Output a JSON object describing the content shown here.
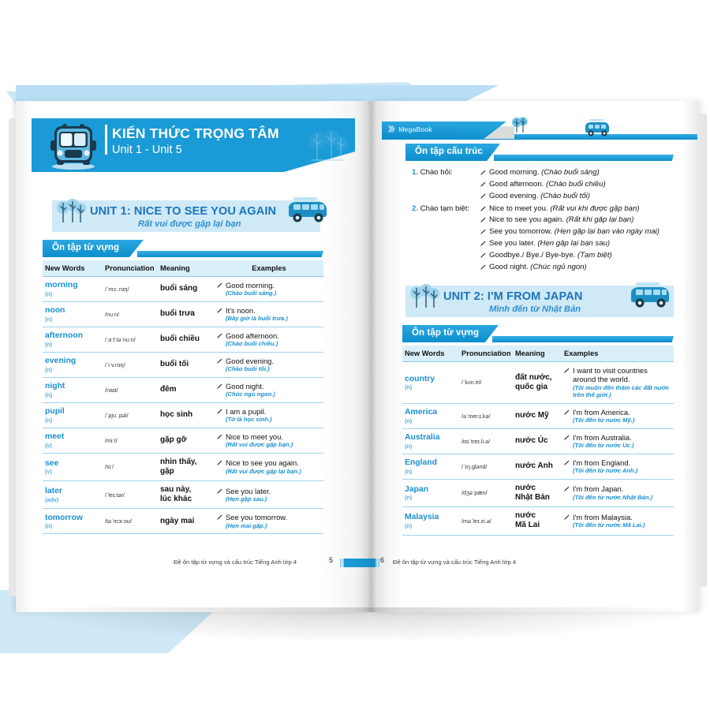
{
  "book": {
    "header": {
      "title": "KIẾN THỨC TRỌNG TÂM",
      "subtitle": "Unit 1 - Unit 5",
      "bus_icon": "school-bus-icon",
      "trees_icon": "trees-icon"
    },
    "brand": {
      "logo_text": "MegaBook",
      "chevrons": "〉〉〉"
    },
    "footer": {
      "left_text": "Đề ôn tập từ vựng và cấu trúc Tiếng Anh lớp 4",
      "left_page": "5",
      "right_page": "6",
      "right_text": "Đề ôn tập từ vựng và cấu trúc Tiếng Anh lớp 4"
    }
  },
  "left_page": {
    "unit": {
      "title": "UNIT 1: NICE TO SEE YOU AGAIN",
      "subtitle": "Rất vui được gặp lại bạn",
      "trees_icon": "trees-icon",
      "van_icon": "van-icon"
    },
    "section": {
      "label": "Ôn tập từ vựng"
    },
    "table": {
      "columns": [
        "New Words",
        "Pronunciation",
        "Meaning",
        "Examples"
      ],
      "rows": [
        {
          "word": "morning",
          "pos": "(n)",
          "ipa": "/ˈmɔː.nɪŋ/",
          "meaning": "buổi sáng",
          "example": "Good morning.",
          "vn": "(Chào buổi sáng.)"
        },
        {
          "word": "noon",
          "pos": "(n)",
          "ipa": "/nuːn/",
          "meaning": "buổi trưa",
          "example": "It's noon.",
          "vn": "(Bây giờ là buổi trưa.)"
        },
        {
          "word": "afternoon",
          "pos": "(n)",
          "ipa": "/ˌɑːf.təˈnuːn/",
          "meaning": "buổi chiều",
          "example": "Good afternoon.",
          "vn": "(Chào buổi chiều.)"
        },
        {
          "word": "evening",
          "pos": "(n)",
          "ipa": "/ˈiːv.nɪŋ/",
          "meaning": "buổi tối",
          "example": "Good evening.",
          "vn": "(Chào buổi tối.)"
        },
        {
          "word": "night",
          "pos": "(n)",
          "ipa": "/naɪt/",
          "meaning": "đêm",
          "example": "Good night.",
          "vn": "(Chúc ngủ ngon.)"
        },
        {
          "word": "pupil",
          "pos": "(n)",
          "ipa": "/ˈpjuː.pəl/",
          "meaning": "học sinh",
          "example": "I am a pupil.",
          "vn": "(Tớ là học sinh.)"
        },
        {
          "word": "meet",
          "pos": "(v)",
          "ipa": "/miːt/",
          "meaning": "gặp gỡ",
          "example": "Nice to meet you.",
          "vn": "(Rất vui được gặp bạn.)"
        },
        {
          "word": "see",
          "pos": "(v)",
          "ipa": "/siː/",
          "meaning": "nhìn thấy, gặp",
          "example": "Nice to see you again.",
          "vn": "(Rất vui được gặp lại bạn.)"
        },
        {
          "word": "later",
          "pos": "(adv)",
          "ipa": "/ˈleɪ.tər/",
          "meaning": "sau này,\nlúc khác",
          "example": "See you later.",
          "vn": "(Hẹn gặp sau.)"
        },
        {
          "word": "tomorrow",
          "pos": "(n)",
          "ipa": "/təˈmɔr.oʊ/",
          "meaning": "ngày mai",
          "example": "See you tomorrow.",
          "vn": "(Hẹn mai gặp.)"
        }
      ]
    }
  },
  "right_page": {
    "structure_section": {
      "label": "Ôn tập cấu trúc"
    },
    "structures": [
      {
        "num": "1.",
        "heading": "Chào hỏi:",
        "items": [
          {
            "en": "Good morning.",
            "vn": "(Chào buổi sáng)"
          },
          {
            "en": "Good afternoon.",
            "vn": "(Chào buổi chiều)"
          },
          {
            "en": "Good evening.",
            "vn": "(Chào buổi tối)"
          }
        ]
      },
      {
        "num": "2.",
        "heading": "Chào tạm biệt:",
        "items": [
          {
            "en": "Nice to meet you.",
            "vn": "(Rất vui khi được gặp bạn)"
          },
          {
            "en": "Nice to see you again.",
            "vn": "(Rất khi gặp lại bạn)"
          },
          {
            "en": "See you tomorrow.",
            "vn": "(Hẹn gặp lại bạn vào ngày mai)"
          },
          {
            "en": "See you later.",
            "vn": "(Hẹn gặp lại bạn sau)"
          },
          {
            "en": "Goodbye./ Bye./ Bye-bye.",
            "vn": "(Tạm biệt)"
          },
          {
            "en": "Good night.",
            "vn": "(Chúc ngủ ngon)"
          }
        ]
      }
    ],
    "unit": {
      "title": "UNIT 2: I'M FROM JAPAN",
      "subtitle": "Mình đến từ Nhật Bản",
      "trees_icon": "trees-icon",
      "van_icon": "van-icon"
    },
    "section": {
      "label": "Ôn tập từ vựng"
    },
    "table": {
      "columns": [
        "New Words",
        "Pronunciation",
        "Meaning",
        "Examples"
      ],
      "rows": [
        {
          "word": "country",
          "pos": "(n)",
          "ipa": "/ˈkʌn.tri/",
          "meaning": "đất nước,\nquốc gia",
          "example": "I want to visit countries around the world.",
          "vn": "(Tôi muốn đến thăm các đất nước trên thế giới.)"
        },
        {
          "word": "America",
          "pos": "(n)",
          "ipa": "/əˈmer.ɪ.kə/",
          "meaning": "nước Mỹ",
          "example": "I'm from America.",
          "vn": "(Tôi đến từ nước Mỹ.)"
        },
        {
          "word": "Australia",
          "pos": "(n)",
          "ipa": "/ɒsˈtreɪ.li.ə/",
          "meaning": "nước Úc",
          "example": "I'm from Australia.",
          "vn": "(Tôi đến từ nước Úc.)"
        },
        {
          "word": "England",
          "pos": "(n)",
          "ipa": "/ˈɪŋ.ɡlənd/",
          "meaning": "nước Anh",
          "example": "I'm from England.",
          "vn": "(Tôi đến từ nước Anh.)"
        },
        {
          "word": "Japan",
          "pos": "(n)",
          "ipa": "/dʒəˈpæn/",
          "meaning": "nước\nNhật Bản",
          "example": "I'm from Japan.",
          "vn": "(Tôi đến từ nước Nhật Bản.)"
        },
        {
          "word": "Malaysia",
          "pos": "(n)",
          "ipa": "/məˈleɪ.zi.ə/",
          "meaning": "nước\nMã Lai",
          "example": "I'm from Malaysia.",
          "vn": "(Tôi đến từ nước Mã Lai.)"
        }
      ]
    }
  },
  "colors": {
    "brand_blue": "#1a9ad6",
    "deep_blue": "#0d8ecd",
    "light_band": "#cfe9f7",
    "title_blue": "#1b75bb",
    "word_blue": "#1a8fd0",
    "table_head": "#d9effa",
    "row_rule": "#9ed3ee"
  }
}
